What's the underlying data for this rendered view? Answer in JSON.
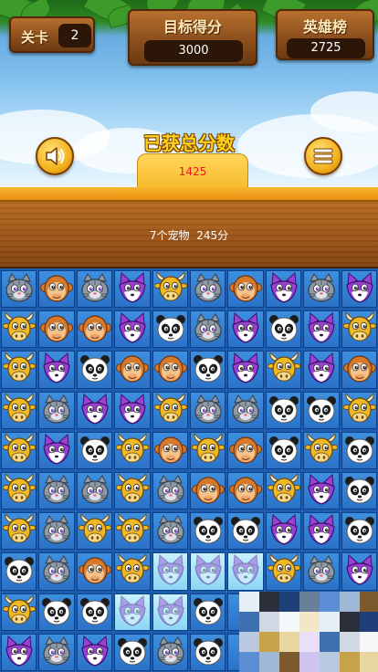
{
  "header": {
    "level": {
      "label": "关卡",
      "value": "2"
    },
    "target": {
      "label": "目标得分",
      "value": "3000"
    },
    "leaderboard": {
      "label": "英雄榜",
      "value": "2725"
    }
  },
  "score_panel": {
    "heading": "已获总分数",
    "total": "1425",
    "status": "7个宠物 245分"
  },
  "buttons": {
    "sound": "speaker-icon",
    "menu": "list-menu-icon"
  },
  "colors": {
    "cat": "#8e9aa6",
    "monkey": "#d6792a",
    "fox": "#9b3fd6",
    "bull": "#f0b823",
    "panda": "#ffffff",
    "tile": "#2f7bd2",
    "tile_selected": "#a9e4f8"
  },
  "board": {
    "rows": [
      [
        "cat",
        "monkey",
        "cat",
        "fox",
        "bull",
        "cat",
        "monkey",
        "fox",
        "cat",
        "fox"
      ],
      [
        "bull",
        "monkey",
        "monkey",
        "fox",
        "panda",
        "cat",
        "fox",
        "panda",
        "fox",
        "bull"
      ],
      [
        "bull",
        "fox",
        "panda",
        "monkey",
        "monkey",
        "panda",
        "fox",
        "bull",
        "fox",
        "monkey"
      ],
      [
        "bull",
        "cat",
        "fox",
        "fox",
        "bull",
        "cat",
        "cat",
        "panda",
        "panda",
        "bull"
      ],
      [
        "bull",
        "fox",
        "panda",
        "bull",
        "monkey",
        "bull",
        "monkey",
        "panda",
        "bull",
        "panda"
      ],
      [
        "bull",
        "cat",
        "cat",
        "bull",
        "cat",
        "monkey",
        "monkey",
        "bull",
        "fox",
        "panda"
      ],
      [
        "bull",
        "cat",
        "bull",
        "bull",
        "cat",
        "panda",
        "panda",
        "fox",
        "fox",
        "panda"
      ],
      [
        "panda",
        "cat",
        "monkey",
        "bull",
        "fox",
        "fox",
        "fox",
        "bull",
        "cat",
        "fox"
      ],
      [
        "bull",
        "panda",
        "panda",
        "fox",
        "fox",
        "panda",
        "",
        "",
        "",
        ""
      ],
      [
        "fox",
        "cat",
        "fox",
        "panda",
        "cat",
        "panda",
        "",
        "",
        "",
        ""
      ]
    ],
    "highlighted": [
      [
        7,
        4
      ],
      [
        7,
        5
      ],
      [
        7,
        6
      ],
      [
        8,
        3
      ],
      [
        8,
        4
      ]
    ]
  }
}
